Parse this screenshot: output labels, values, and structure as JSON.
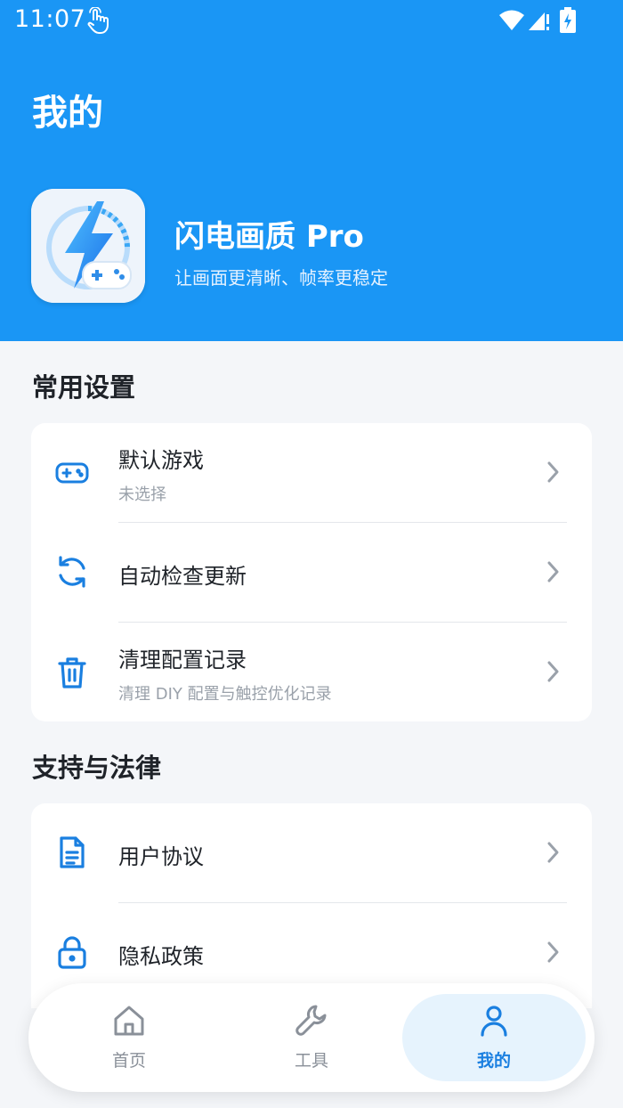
{
  "status_bar": {
    "time": "11:07"
  },
  "header": {
    "title": "我的",
    "app_name": "闪电画质 Pro",
    "tagline": "让画面更清晰、帧率更稳定"
  },
  "sections": {
    "common": {
      "title": "常用设置",
      "items": [
        {
          "title": "默认游戏",
          "subtitle": "未选择",
          "icon": "gamepad-icon"
        },
        {
          "title": "自动检查更新",
          "icon": "refresh-icon"
        },
        {
          "title": "清理配置记录",
          "subtitle": "清理 DIY 配置与触控优化记录",
          "icon": "trash-icon"
        }
      ]
    },
    "support": {
      "title": "支持与法律",
      "items": [
        {
          "title": "用户协议",
          "icon": "document-icon"
        },
        {
          "title": "隐私政策",
          "icon": "lock-icon"
        }
      ]
    }
  },
  "bottom_nav": {
    "items": [
      {
        "label": "首页",
        "icon": "home-icon"
      },
      {
        "label": "工具",
        "icon": "wrench-icon"
      },
      {
        "label": "我的",
        "icon": "user-icon",
        "active": true
      }
    ]
  },
  "colors": {
    "header_bg": "#1a96f5",
    "accent": "#1a7fe0",
    "page_bg": "#f4f6f9"
  }
}
